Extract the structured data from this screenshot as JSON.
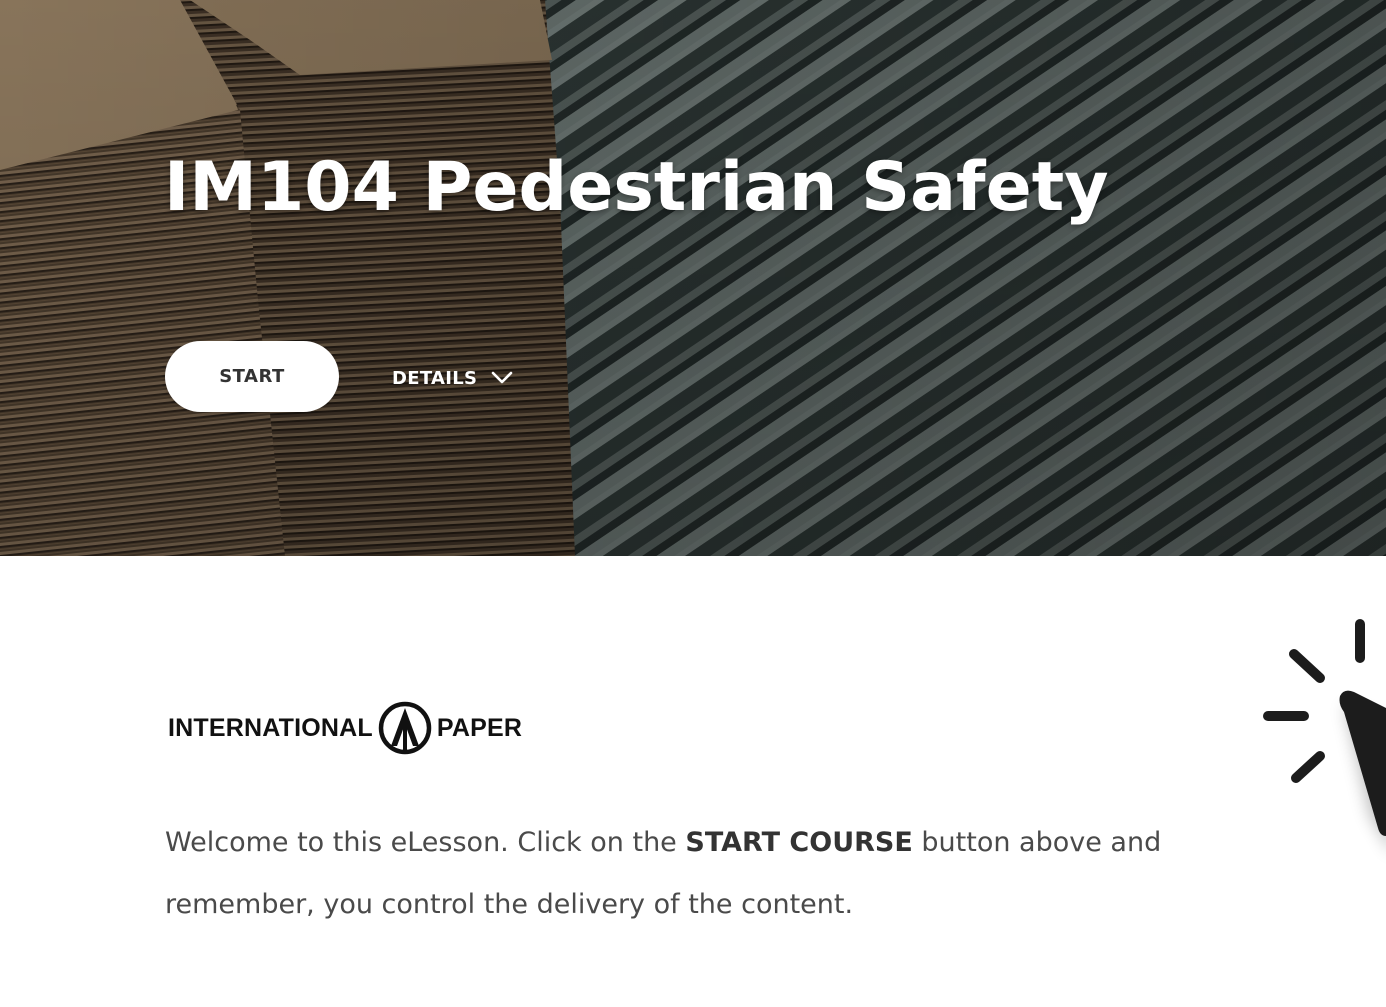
{
  "hero": {
    "title": "IM104 Pedestrian Safety",
    "start_label": "START",
    "details_label": "DETAILS"
  },
  "logo": {
    "left_word": "INTERNATIONAL",
    "right_word": "PAPER"
  },
  "intro": {
    "part1": "Welcome to this eLesson.  Click on the ",
    "emphasis": "START COURSE",
    "part2": " button above and remember, you control the delivery of the content."
  },
  "icons": {
    "chevron": "chevron-down-icon",
    "logo_mark": "international-paper-logo-icon",
    "click": "click-cursor-icon"
  },
  "colors": {
    "title": "#ffffff",
    "button_bg": "#ffffff",
    "button_text": "#333333",
    "body_text": "#4a4a4a",
    "cardboard": "#6b5a44",
    "steel": "#44524f"
  }
}
